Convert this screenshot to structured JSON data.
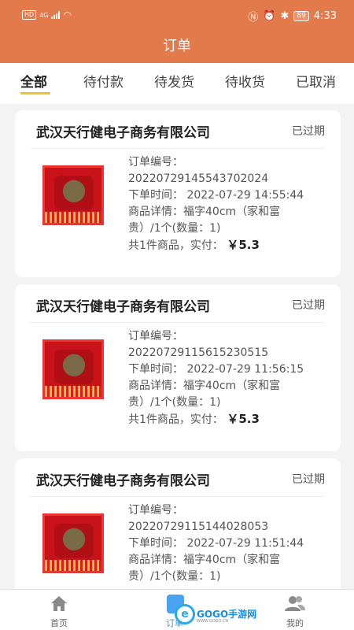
{
  "status_bar": {
    "hd": "HD",
    "network": "4G",
    "battery": "89",
    "time": "4:33"
  },
  "header": {
    "title": "订单"
  },
  "tabs": [
    {
      "label": "全部",
      "active": true
    },
    {
      "label": "待付款"
    },
    {
      "label": "待发货"
    },
    {
      "label": "待收货"
    },
    {
      "label": "已取消"
    }
  ],
  "orders": [
    {
      "shop": "武汉天行健电子商务有限公司",
      "status": "已过期",
      "order_no_label": "订单编号：",
      "order_no": "20220729145543702024",
      "time": "下单时间：  2022-07-29 14:55:44",
      "detail1": "商品详情：福字40cm（家和富",
      "detail2": "贵）/1个(数量：1)",
      "total_prefix": "共1件商品，实付：",
      "total": "￥5.3"
    },
    {
      "shop": "武汉天行健电子商务有限公司",
      "status": "已过期",
      "order_no_label": "订单编号：",
      "order_no": "20220729115615230515",
      "time": "下单时间：  2022-07-29 11:56:15",
      "detail1": "商品详情：福字40cm（家和富",
      "detail2": "贵）/1个(数量：1)",
      "total_prefix": "共1件商品，实付：",
      "total": "￥5.3"
    },
    {
      "shop": "武汉天行健电子商务有限公司",
      "status": "已过期",
      "order_no_label": "订单编号：",
      "order_no": "20220729115144028053",
      "time": "下单时间：  2022-07-29 11:51:44",
      "detail1": "商品详情：福字40cm（家和富",
      "detail2": "贵）/1个(数量：1)"
    }
  ],
  "bottom_nav": {
    "home": "首页",
    "orders": "订单",
    "mine": "我的",
    "watermark": "GOGO手游网",
    "watermark_url": "WWW.GOGO.CN"
  },
  "colors": {
    "header_bg": "#e27a4c",
    "tab_indicator": "#f2c21c"
  }
}
